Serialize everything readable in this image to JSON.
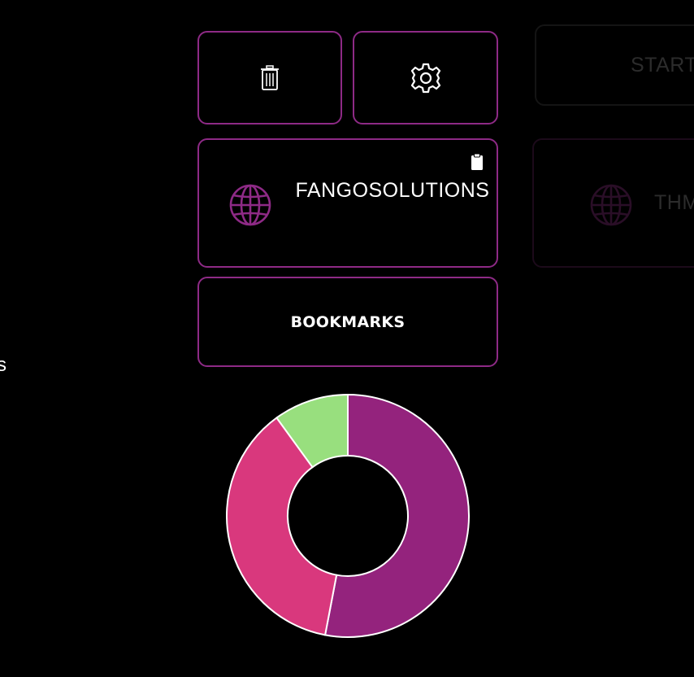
{
  "actions": {
    "delete_icon": "trash-icon",
    "settings_icon": "gear-icon"
  },
  "bookmark_card": {
    "title": "FANGOSOLUTIONS",
    "icon": "globe-icon",
    "clipboard_icon": "clipboard-icon"
  },
  "bookmarks_button": {
    "label": "BOOKMARKS"
  },
  "next_column": {
    "start_label": "START",
    "card_title": "THM"
  },
  "left_panel": {
    "partial_text": "s"
  },
  "colors": {
    "accent": "#8e2a86",
    "purple": "#94237d",
    "pink": "#d9387d",
    "green": "#98df7e"
  },
  "chart_data": {
    "type": "pie",
    "variant": "donut",
    "slices": [
      {
        "value": 53,
        "color": "#94237d"
      },
      {
        "value": 37,
        "color": "#d9387d"
      },
      {
        "value": 10,
        "color": "#98df7e"
      }
    ]
  }
}
